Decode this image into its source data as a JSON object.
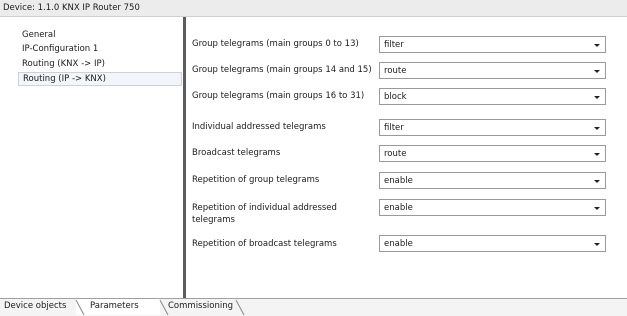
{
  "window": {
    "title": "Device: 1.1.0  KNX IP Router 750"
  },
  "sidebar": {
    "items": [
      {
        "label": "General"
      },
      {
        "label": "IP-Configuration 1"
      },
      {
        "label": "Routing (KNX -> IP)"
      },
      {
        "label": "Routing (IP -> KNX)"
      }
    ]
  },
  "parameters": [
    {
      "label": "Group telegrams (main groups 0 to 13)",
      "value": "filter"
    },
    {
      "label": "Group telegrams (main groups 14 and 15)",
      "value": "route"
    },
    {
      "label": "Group telegrams (main groups 16 to 31)",
      "value": "block"
    },
    {
      "label": "Individual addressed telegrams",
      "value": "filter"
    },
    {
      "label": "Broadcast telegrams",
      "value": "route"
    },
    {
      "label": "Repetition of group telegrams",
      "value": "enable"
    },
    {
      "label_line1": "Repetition of individual addressed",
      "label_line2": "telegrams",
      "value": "enable"
    },
    {
      "label": "Repetition of broadcast telegrams",
      "value": "enable"
    }
  ],
  "tabs": [
    {
      "label": "Device objects"
    },
    {
      "label": "Parameters"
    },
    {
      "label": "Commissioning"
    }
  ]
}
